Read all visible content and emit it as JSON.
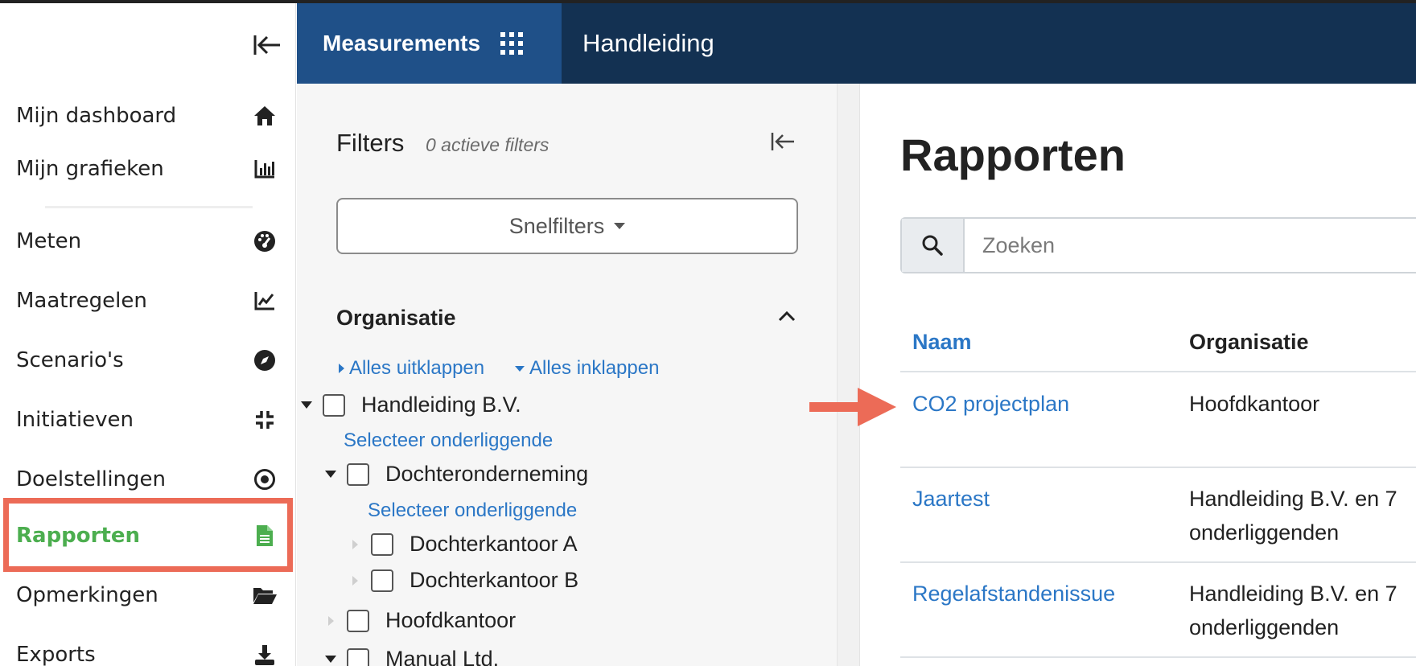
{
  "sidebar": {
    "items": [
      {
        "label": "Mijn dashboard",
        "icon": "home-icon"
      },
      {
        "label": "Mijn grafieken",
        "icon": "bar-chart-icon"
      },
      {
        "label": "Meten",
        "icon": "gauge-icon"
      },
      {
        "label": "Maatregelen",
        "icon": "line-chart-icon"
      },
      {
        "label": "Scenario's",
        "icon": "compass-icon"
      },
      {
        "label": "Initiatieven",
        "icon": "compress-icon"
      },
      {
        "label": "Doelstellingen",
        "icon": "target-icon"
      },
      {
        "label": "Rapporten",
        "icon": "file-icon",
        "active": true
      },
      {
        "label": "Opmerkingen",
        "icon": "folder-open-icon"
      },
      {
        "label": "Exports",
        "icon": "download-icon"
      }
    ]
  },
  "header": {
    "brand": "Measurements",
    "title": "Handleiding"
  },
  "filters": {
    "title": "Filters",
    "active_count": "0 actieve filters",
    "quick_filters": "Snelfilters",
    "organisation_title": "Organisatie",
    "expand_all": "Alles uitklappen",
    "collapse_all": "Alles inklappen",
    "select_children": "Selecteer onderliggende",
    "tree": [
      {
        "label": "Handleiding B.V."
      },
      {
        "label": "Dochteronderneming"
      },
      {
        "label": "Dochterkantoor A"
      },
      {
        "label": "Dochterkantoor B"
      },
      {
        "label": "Hoofdkantoor"
      },
      {
        "label": "Manual Ltd."
      }
    ]
  },
  "main": {
    "title": "Rapporten",
    "search_placeholder": "Zoeken",
    "columns": [
      "Naam",
      "Organisatie"
    ],
    "rows": [
      {
        "name": "CO2 projectplan",
        "org": "Hoofdkantoor"
      },
      {
        "name": "Jaartest",
        "org": "Handleiding B.V. en 7 onderliggenden"
      },
      {
        "name": "Regelafstandenissue",
        "org": "Handleiding B.V. en 7 onderliggenden"
      }
    ]
  },
  "colors": {
    "header_bg": "#133152",
    "brand_bg": "#1f5088",
    "active_green": "#4cae4f",
    "link_blue": "#2b77c6",
    "annotation": "#ec6b57"
  }
}
